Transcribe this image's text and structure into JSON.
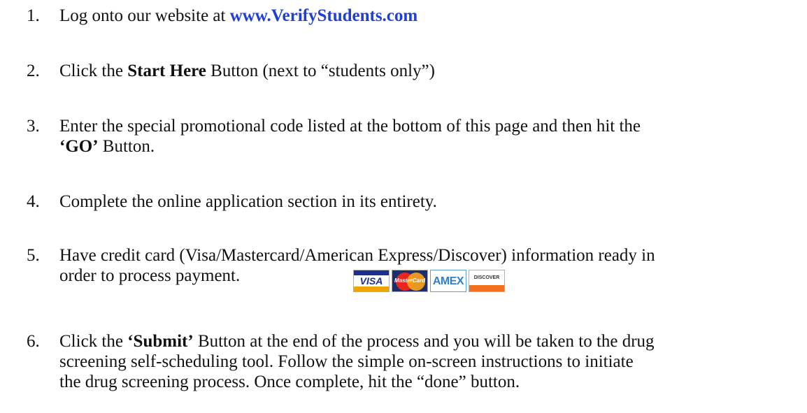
{
  "steps": [
    {
      "number": "1.",
      "text_before": "Log onto our website at ",
      "link": "www.VerifyStudents.com"
    },
    {
      "number": "2.",
      "text_before": "Click the ",
      "bold": "Start Here",
      "text_after": " Button (next to “students only”)"
    },
    {
      "number": "3.",
      "line1": "Enter the special promotional code listed at the bottom of this page and then hit the",
      "bold": "‘GO’",
      "text_after": " Button."
    },
    {
      "number": "4.",
      "text": "Complete the online application section in its entirety."
    },
    {
      "number": "5.",
      "line1": "Have credit card (Visa/Mastercard/American Express/Discover) information ready in",
      "line2": "order to process payment."
    },
    {
      "number": "6.",
      "text_before": "Click the ",
      "bold": "‘Submit’",
      "line1_after": " Button at the end of the process and you will be taken to the drug",
      "line2": "screening self-scheduling tool.  Follow the simple on-screen instructions to initiate",
      "line3": "the drug screening process.  Once complete, hit the “done” button."
    }
  ],
  "card_logos": {
    "visa": "VISA",
    "mastercard": "MasterCard",
    "amex": "AMEX",
    "discover": "DISCOVER"
  },
  "colors": {
    "link": "#1f3fd6",
    "text": "#111111"
  }
}
